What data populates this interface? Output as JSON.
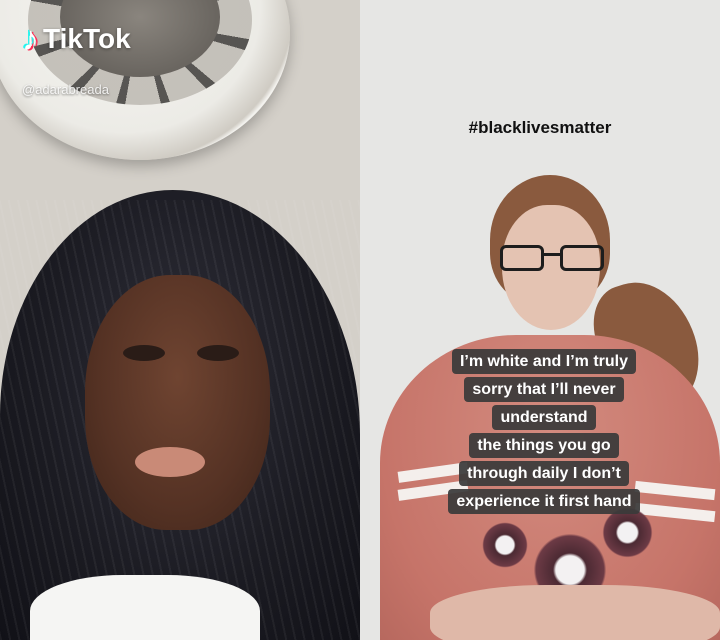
{
  "app": {
    "brand": "TikTok",
    "handle": "@adarabreada",
    "icons": {
      "logo": "tiktok-note-icon"
    },
    "colors": {
      "cyan": "#25f4ee",
      "red": "#fe2c55"
    }
  },
  "right_video": {
    "hashtag": "#blacklivesmatter",
    "caption_lines": [
      "I’m white and I’m truly",
      "sorry that I’ll never",
      "understand",
      "the things you go",
      "through daily I don’t",
      "experience it first hand"
    ]
  }
}
